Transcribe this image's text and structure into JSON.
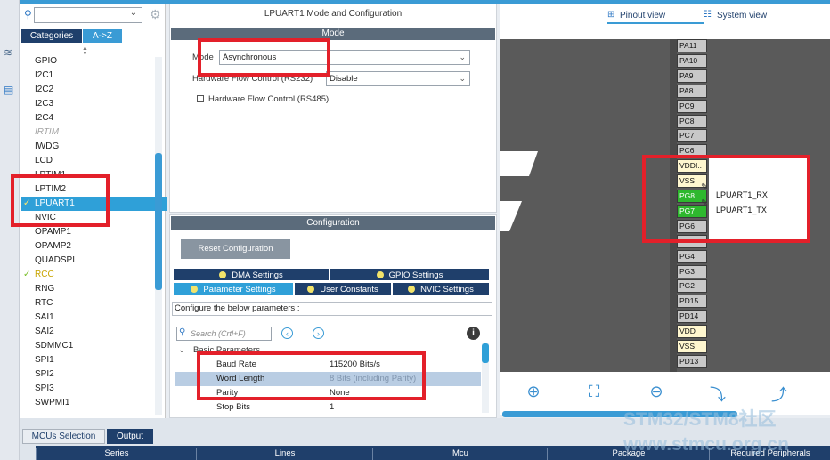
{
  "search": {
    "placeholder": ""
  },
  "left_tabs": {
    "categories": "Categories",
    "az": "A->Z"
  },
  "peripherals": [
    {
      "label": "GPIO",
      "state": "normal"
    },
    {
      "label": "I2C1",
      "state": "normal"
    },
    {
      "label": "I2C2",
      "state": "normal"
    },
    {
      "label": "I2C3",
      "state": "normal"
    },
    {
      "label": "I2C4",
      "state": "normal"
    },
    {
      "label": "IRTIM",
      "state": "disabled"
    },
    {
      "label": "IWDG",
      "state": "normal"
    },
    {
      "label": "LCD",
      "state": "normal"
    },
    {
      "label": "LPTIM1",
      "state": "normal"
    },
    {
      "label": "LPTIM2",
      "state": "normal"
    },
    {
      "label": "LPUART1",
      "state": "selected"
    },
    {
      "label": "NVIC",
      "state": "normal"
    },
    {
      "label": "OPAMP1",
      "state": "normal"
    },
    {
      "label": "OPAMP2",
      "state": "normal"
    },
    {
      "label": "QUADSPI",
      "state": "normal"
    },
    {
      "label": "RCC",
      "state": "configured"
    },
    {
      "label": "RNG",
      "state": "normal"
    },
    {
      "label": "RTC",
      "state": "normal"
    },
    {
      "label": "SAI1",
      "state": "normal"
    },
    {
      "label": "SAI2",
      "state": "normal"
    },
    {
      "label": "SDMMC1",
      "state": "normal"
    },
    {
      "label": "SPI1",
      "state": "normal"
    },
    {
      "label": "SPI2",
      "state": "normal"
    },
    {
      "label": "SPI3",
      "state": "normal"
    },
    {
      "label": "SWPMI1",
      "state": "normal"
    }
  ],
  "mode_panel": {
    "title": "LPUART1 Mode and Configuration",
    "header": "Mode",
    "mode_label": "Mode",
    "mode_value": "Asynchronous",
    "flow_label": "Hardware Flow Control (RS232)",
    "flow_value": "Disable",
    "rs485_label": "Hardware Flow Control (RS485)"
  },
  "config_panel": {
    "header": "Configuration",
    "reset_label": "Reset Configuration",
    "tabs_row1": [
      "DMA Settings",
      "GPIO Settings"
    ],
    "tabs_row2": [
      "Parameter Settings",
      "User Constants",
      "NVIC Settings"
    ],
    "description": "Configure the below parameters :",
    "search_placeholder": "Search (Crtl+F)",
    "group": "Basic Parameters",
    "params": [
      {
        "name": "Baud Rate",
        "value": "115200 Bits/s"
      },
      {
        "name": "Word Length",
        "value": "8 Bits (including Parity)"
      },
      {
        "name": "Parity",
        "value": "None"
      },
      {
        "name": "Stop Bits",
        "value": "1"
      }
    ]
  },
  "views": {
    "pinout": "Pinout view",
    "system": "System view"
  },
  "pins": [
    {
      "label": "PA11",
      "type": "normal"
    },
    {
      "label": "PA10",
      "type": "normal"
    },
    {
      "label": "PA9",
      "type": "normal"
    },
    {
      "label": "PA8",
      "type": "normal"
    },
    {
      "label": "PC9",
      "type": "normal"
    },
    {
      "label": "PC8",
      "type": "normal"
    },
    {
      "label": "PC7",
      "type": "normal"
    },
    {
      "label": "PC6",
      "type": "normal"
    },
    {
      "label": "VDDI..",
      "type": "power"
    },
    {
      "label": "VSS",
      "type": "power"
    },
    {
      "label": "PG8",
      "type": "active"
    },
    {
      "label": "PG7",
      "type": "active"
    },
    {
      "label": "PG6",
      "type": "normal"
    },
    {
      "label": "",
      "type": "normal"
    },
    {
      "label": "PG4",
      "type": "normal"
    },
    {
      "label": "PG3",
      "type": "normal"
    },
    {
      "label": "PG2",
      "type": "normal"
    },
    {
      "label": "PD15",
      "type": "normal"
    },
    {
      "label": "PD14",
      "type": "normal"
    },
    {
      "label": "VDD",
      "type": "power"
    },
    {
      "label": "VSS",
      "type": "power"
    },
    {
      "label": "PD13",
      "type": "normal"
    }
  ],
  "pin_signals": {
    "rx": "LPUART1_RX",
    "tx": "LPUART1_TX"
  },
  "bottom_tabs": {
    "mcu": "MCUs Selection",
    "output": "Output"
  },
  "table_headers": [
    "Series",
    "Lines",
    "Mcu",
    "Package",
    "Required Peripherals"
  ],
  "watermark": {
    "line1": "STM32/STM8社区",
    "line2": "www.stmcu.org.cn"
  },
  "colors": {
    "accent": "#3a9bd5",
    "navy": "#1f3f6b",
    "highlight": "#e3202a",
    "pin_active": "#2eb82e"
  }
}
